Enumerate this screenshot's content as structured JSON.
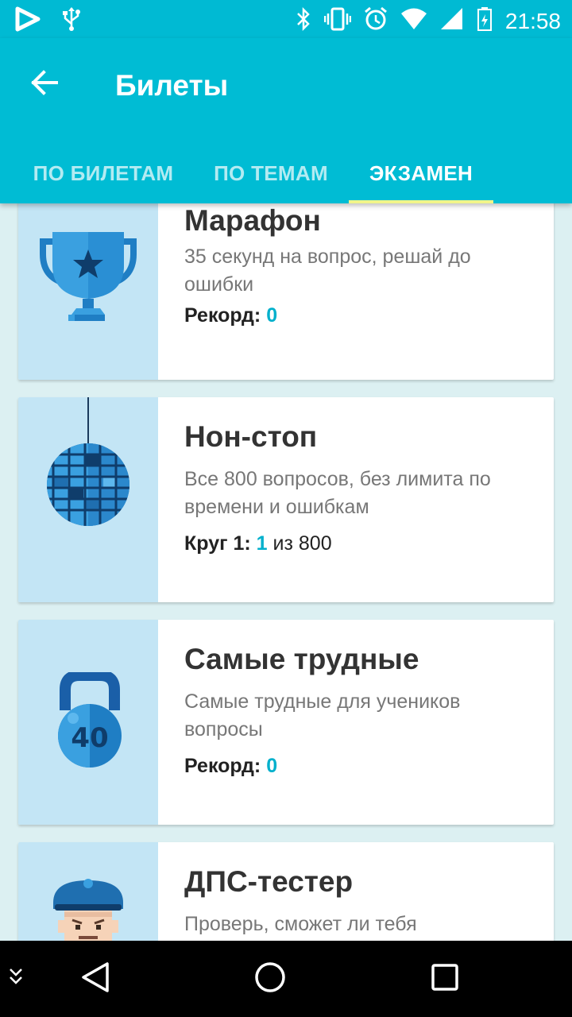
{
  "status_bar": {
    "time": "21:58",
    "icons": [
      "play-store-icon",
      "usb-icon",
      "bluetooth-icon",
      "vibrate-icon",
      "alarm-icon",
      "wifi-icon",
      "signal-icon",
      "battery-icon"
    ]
  },
  "app_bar": {
    "title": "Билеты",
    "back_icon": "arrow-left-icon",
    "tabs": [
      {
        "label": "ПО БИЛЕТАМ",
        "active": false
      },
      {
        "label": "ПО ТЕМАМ",
        "active": false
      },
      {
        "label": "ЭКЗАМЕН",
        "active": true
      }
    ],
    "indicator_color": "#f1f58a",
    "color": "#00bcd4"
  },
  "cards": [
    {
      "icon": "trophy-icon",
      "title": "Марафон",
      "description": "35 секунд на вопрос, решай до ошибки",
      "stat_label": "Рекорд:",
      "stat_value": "0",
      "stat_suffix": ""
    },
    {
      "icon": "disco-ball-icon",
      "title": "Нон-стоп",
      "description": "Все 800 вопросов, без лимита по времени и ошибкам",
      "stat_label": "Круг 1:",
      "stat_value": "1",
      "stat_suffix": "из 800"
    },
    {
      "icon": "kettlebell-icon",
      "icon_text": "40",
      "title": "Самые трудные",
      "description": "Самые трудные для учеников вопросы",
      "stat_label": "Рекорд:",
      "stat_value": "0",
      "stat_suffix": ""
    },
    {
      "icon": "police-officer-icon",
      "title": "ДПС-тестер",
      "description": "Проверь, сможет ли тебя"
    }
  ],
  "nav_bar": {
    "buttons": [
      "collapse-icon",
      "back-triangle-icon",
      "home-circle-icon",
      "recents-square-icon"
    ]
  },
  "colors": {
    "accent": "#00b0cc",
    "art_background": "#c3e5f5",
    "page_background": "#dcf0f2"
  }
}
